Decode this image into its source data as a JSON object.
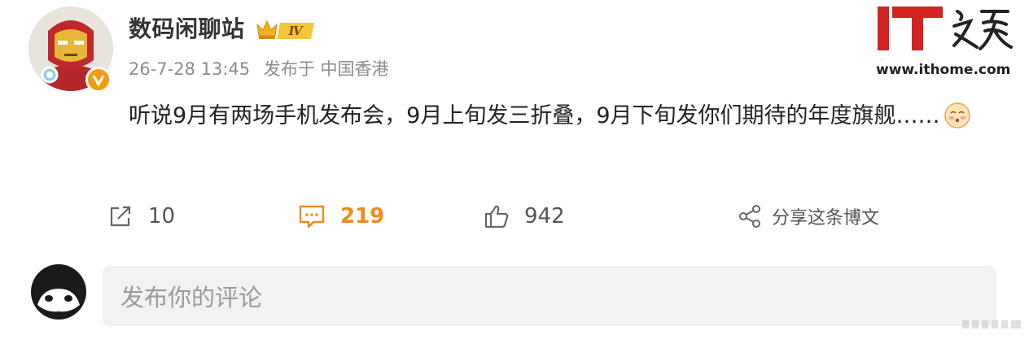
{
  "post": {
    "author": "数码闲聊站",
    "level": "Ⅳ",
    "date": "26-7-28 13:45",
    "published_at": "发布于 中国香港",
    "text": "听说9月有两场手机发布会，9月上旬发三折叠，9月下旬发你们期待的年度旗舰……"
  },
  "actions": {
    "repost_count": "10",
    "comment_count": "219",
    "like_count": "942",
    "share_label": "分享这条博文"
  },
  "comment_box": {
    "placeholder": "发布你的评论"
  },
  "watermark": {
    "logo_text": "IT之家",
    "url": "www.ithome.com"
  },
  "colors": {
    "accent": "#f08a1c",
    "verify_badge": "#f39c12",
    "watermark_red": "#d22222",
    "meta_text": "#8c8c8c",
    "comment_bg": "#f2f2f2"
  },
  "icons": {
    "repost": "repost-icon",
    "comment": "comment-icon",
    "like": "like-icon",
    "share": "share-icon",
    "verify": "verified-v-icon",
    "level": "crown-level-icon",
    "emoji": "shy-face-emoji-icon"
  }
}
